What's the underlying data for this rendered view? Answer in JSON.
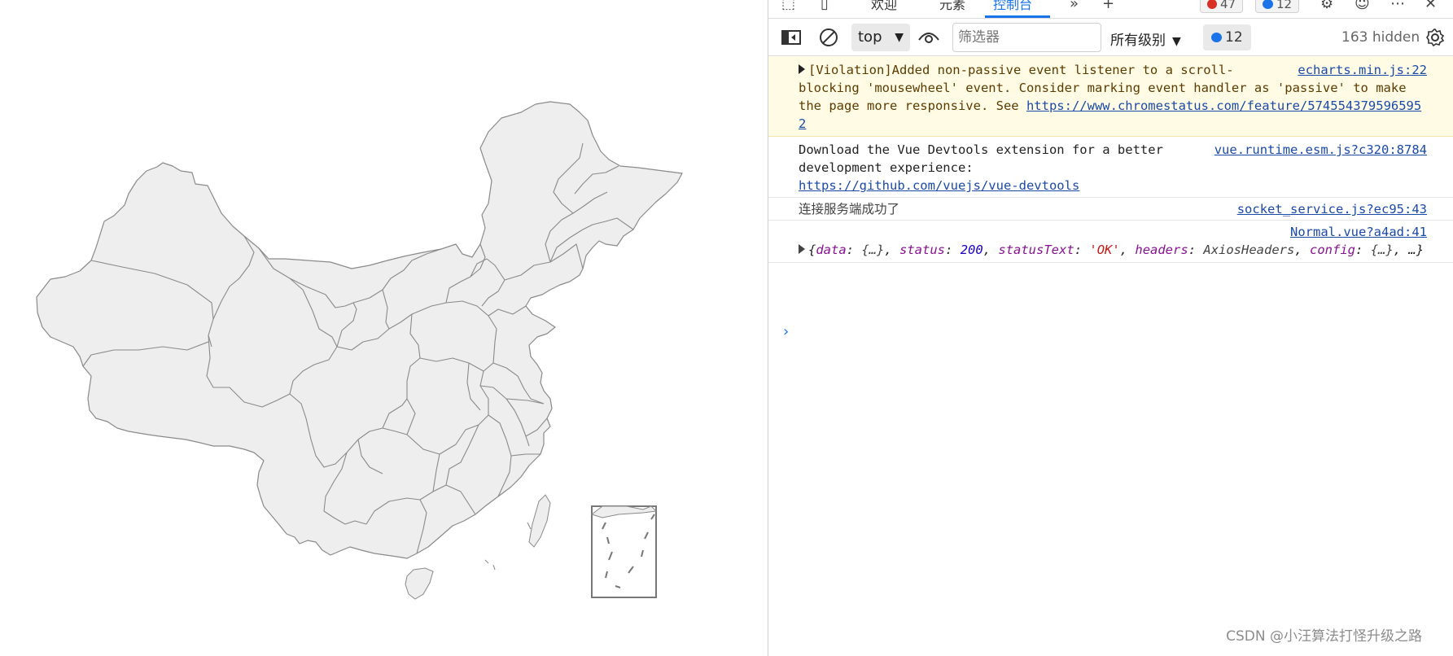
{
  "devtools": {
    "tabs": [
      {
        "label": "欢迎",
        "active": false
      },
      {
        "label": "元素",
        "active": false
      },
      {
        "label": "控制台",
        "active": true
      }
    ],
    "error_count": "47",
    "message_count": "12",
    "toolbar": {
      "context": "top",
      "filter_placeholder": "筛选器",
      "level": "所有级别",
      "issues_count": "12",
      "hidden": "163 hidden"
    },
    "console": {
      "violation": {
        "source": "echarts.min.js:22",
        "text": "[Violation]Added non-passive event listener to a scroll-blocking 'mousewheel' event. Consider marking event handler as 'passive' to make the page more responsive. See ",
        "link": "https://www.chromestatus.com/feature/5745543795965952"
      },
      "vue": {
        "source": "vue.runtime.esm.js?c320:8784",
        "text": "Download the Vue Devtools extension for a better development experience:",
        "link": "https://github.com/vuejs/vue-devtools"
      },
      "socket": {
        "source": "socket_service.js?ec95:43",
        "text": "连接服务端成功了"
      },
      "normal": {
        "source": "Normal.vue?a4ad:41",
        "k_data": "data",
        "v_data": "{…}",
        "k_status": "status",
        "v_status": "200",
        "k_statusText": "statusText",
        "v_statusText": "'OK'",
        "k_headers": "headers",
        "v_headers": "AxiosHeaders",
        "k_config": "config",
        "v_config": "{…}",
        "tail": "…"
      }
    }
  },
  "watermark": "CSDN @小汪算法打怪升级之路",
  "colors": {
    "map_fill": "#eeeeee",
    "map_stroke": "#8a8a8a",
    "accent": "#1a73e8",
    "warning_bg": "#fffbe5"
  }
}
